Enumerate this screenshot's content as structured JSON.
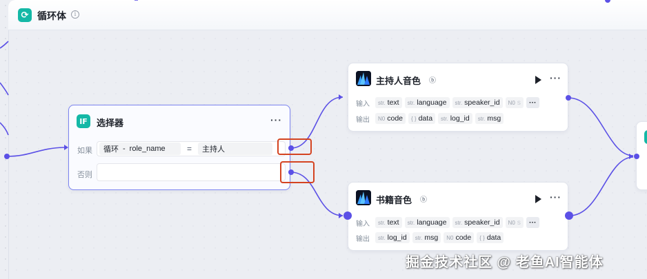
{
  "loop": {
    "title": "循环体",
    "info_icon": "info-circle-icon"
  },
  "selector": {
    "icon_text": "IF",
    "title": "选择器",
    "more": "···",
    "if_label": "如果",
    "else_label": "否则",
    "condition": {
      "left_a": "循环",
      "sep": "-",
      "left_b": "role_name",
      "op": "=",
      "right": "主持人"
    }
  },
  "host_node": {
    "title": "主持人音色",
    "bot_icon": "ⓑ",
    "more": "···",
    "input_label": "输入",
    "output_label": "输出",
    "inputs": [
      {
        "type": "str.",
        "name": "text"
      },
      {
        "type": "str.",
        "name": "language"
      },
      {
        "type": "str.",
        "name": "speaker_id"
      },
      {
        "type": "N0",
        "name": "s"
      }
    ],
    "outputs": [
      {
        "type": "N0",
        "name": "code"
      },
      {
        "type": "{ }",
        "name": "data"
      },
      {
        "type": "str.",
        "name": "log_id"
      },
      {
        "type": "str.",
        "name": "msg"
      }
    ],
    "overflow": "···"
  },
  "book_node": {
    "title": "书籍音色",
    "bot_icon": "ⓑ",
    "more": "···",
    "input_label": "输入",
    "output_label": "输出",
    "inputs": [
      {
        "type": "str.",
        "name": "text"
      },
      {
        "type": "str.",
        "name": "language"
      },
      {
        "type": "str.",
        "name": "speaker_id"
      },
      {
        "type": "N0",
        "name": "s"
      }
    ],
    "outputs": [
      {
        "type": "str.",
        "name": "log_id"
      },
      {
        "type": "str.",
        "name": "msg"
      },
      {
        "type": "N0",
        "name": "code"
      },
      {
        "type": "{ }",
        "name": "data"
      }
    ],
    "overflow": "···"
  },
  "watermark": "掘金技术社区 @ 老鱼AI智能体",
  "colors": {
    "edge": "#5b50e6",
    "highlight": "#d44320",
    "accent": "#14b8a6",
    "selected_border": "#7b83f0"
  }
}
